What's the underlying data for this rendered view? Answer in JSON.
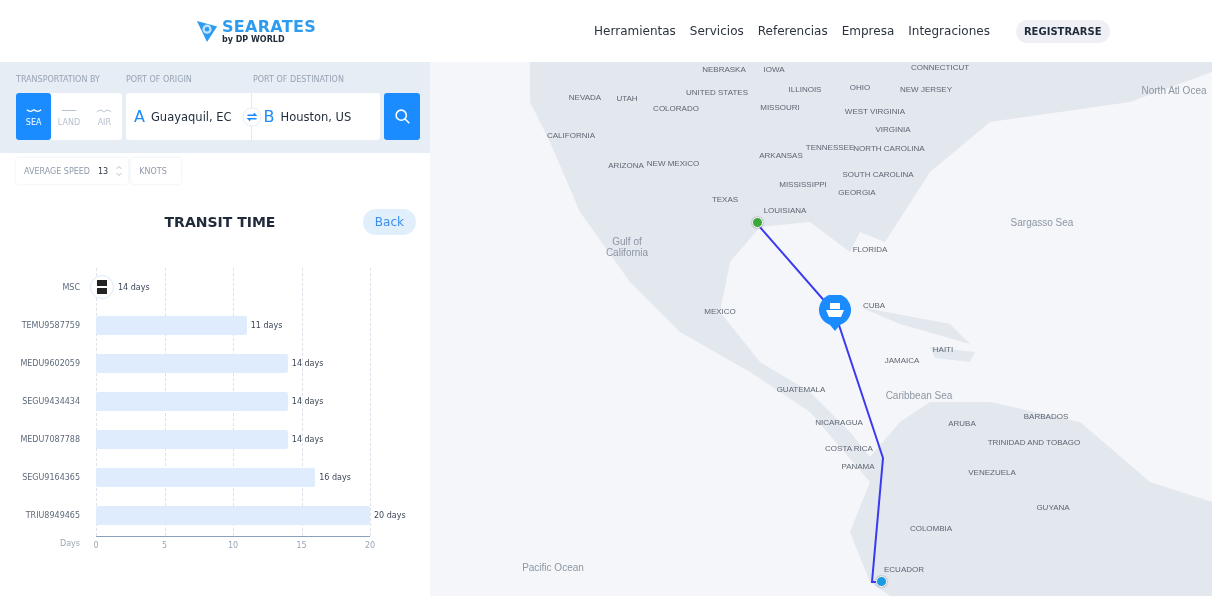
{
  "header": {
    "logo": {
      "name": "SEARATES",
      "sub": "by DP WORLD"
    },
    "nav": [
      {
        "label": "Herramientas"
      },
      {
        "label": "Servicios"
      },
      {
        "label": "Referencias"
      },
      {
        "label": "Empresa"
      },
      {
        "label": "Integraciones"
      }
    ],
    "cta": "REGISTRARSE"
  },
  "search": {
    "transport_label": "TRANSPORTATION BY",
    "origin_label": "PORT OF ORIGIN",
    "destination_label": "PORT OF DESTINATION",
    "modes": [
      {
        "kind": "sea",
        "label": "SEA",
        "selected": true
      },
      {
        "kind": "land",
        "label": "LAND",
        "selected": false
      },
      {
        "kind": "air",
        "label": "AIR",
        "selected": false
      }
    ],
    "origin": {
      "letter": "A",
      "value": "Guayaquil, EC"
    },
    "destination": {
      "letter": "B",
      "value": "Houston, US"
    }
  },
  "speed": {
    "label": "AVERAGE SPEED",
    "value": "13",
    "unit": "KNOTS"
  },
  "transit": {
    "title": "TRANSIT TIME",
    "back": "Back",
    "carrier": {
      "name": "MSC",
      "time": "14 days"
    },
    "chart_data": {
      "type": "bar",
      "orientation": "horizontal",
      "xlabel": "Days",
      "categories": [
        "TEMU9587759",
        "MEDU9602059",
        "SEGU9434434",
        "MEDU7087788",
        "SEGU9164365",
        "TRIU8949465"
      ],
      "values": [
        11,
        14,
        14,
        14,
        16,
        20
      ],
      "xlim": [
        0,
        20
      ],
      "grid": true,
      "xticks": [
        0,
        5,
        10,
        15,
        20
      ],
      "value_labels": [
        "11 days",
        "14 days",
        "14 days",
        "14 days",
        "16 days",
        "20 days"
      ]
    }
  },
  "map": {
    "labels": [
      {
        "kind": "land",
        "text": "NEBRASKA"
      },
      {
        "kind": "land",
        "text": "IOWA"
      },
      {
        "kind": "land",
        "text": "CONNECTICUT"
      },
      {
        "kind": "land",
        "text": "UNITED STATES"
      },
      {
        "kind": "land",
        "text": "ILLINOIS"
      },
      {
        "kind": "land",
        "text": "OHIO"
      },
      {
        "kind": "land",
        "text": "NEW JERSEY"
      },
      {
        "kind": "land",
        "text": "NEVADA"
      },
      {
        "kind": "land",
        "text": "UTAH"
      },
      {
        "kind": "land",
        "text": "COLORADO"
      },
      {
        "kind": "land",
        "text": "MISSOURI"
      },
      {
        "kind": "land",
        "text": "WEST VIRGINIA"
      },
      {
        "kind": "land",
        "text": "VIRGINIA"
      },
      {
        "kind": "land",
        "text": "CALIFORNIA"
      },
      {
        "kind": "land",
        "text": "ARKANSAS"
      },
      {
        "kind": "land",
        "text": "TENNESSEE"
      },
      {
        "kind": "land",
        "text": "NORTH CAROLINA"
      },
      {
        "kind": "land",
        "text": "ARIZONA"
      },
      {
        "kind": "land",
        "text": "NEW MEXICO"
      },
      {
        "kind": "land",
        "text": "SOUTH CAROLINA"
      },
      {
        "kind": "land",
        "text": "MISSISSIPPI"
      },
      {
        "kind": "land",
        "text": "GEORGIA"
      },
      {
        "kind": "land",
        "text": "TEXAS"
      },
      {
        "kind": "land",
        "text": "LOUISIANA"
      },
      {
        "kind": "land",
        "text": "FLORIDA"
      },
      {
        "kind": "land",
        "text": "CUBA"
      },
      {
        "kind": "land",
        "text": "MEXICO"
      },
      {
        "kind": "land",
        "text": "HAITI"
      },
      {
        "kind": "land",
        "text": "JAMAICA"
      },
      {
        "kind": "land",
        "text": "GUATEMALA"
      },
      {
        "kind": "land",
        "text": "NICARAGUA"
      },
      {
        "kind": "land",
        "text": "ARUBA"
      },
      {
        "kind": "land",
        "text": "BARBADOS"
      },
      {
        "kind": "land",
        "text": "TRINIDAD AND TOBAGO"
      },
      {
        "kind": "land",
        "text": "COSTA RICA"
      },
      {
        "kind": "land",
        "text": "PANAMA"
      },
      {
        "kind": "land",
        "text": "VENEZUELA"
      },
      {
        "kind": "land",
        "text": "GUYANA"
      },
      {
        "kind": "land",
        "text": "COLOMBIA"
      },
      {
        "kind": "land",
        "text": "ECUADOR"
      },
      {
        "kind": "water",
        "text": "North Atl Ocea"
      },
      {
        "kind": "water",
        "text": "Sargasso Sea"
      },
      {
        "kind": "water",
        "text": "Gulf of California"
      },
      {
        "kind": "water",
        "text": "Caribbean Sea"
      },
      {
        "kind": "water",
        "text": "Pacific Ocean"
      }
    ]
  }
}
